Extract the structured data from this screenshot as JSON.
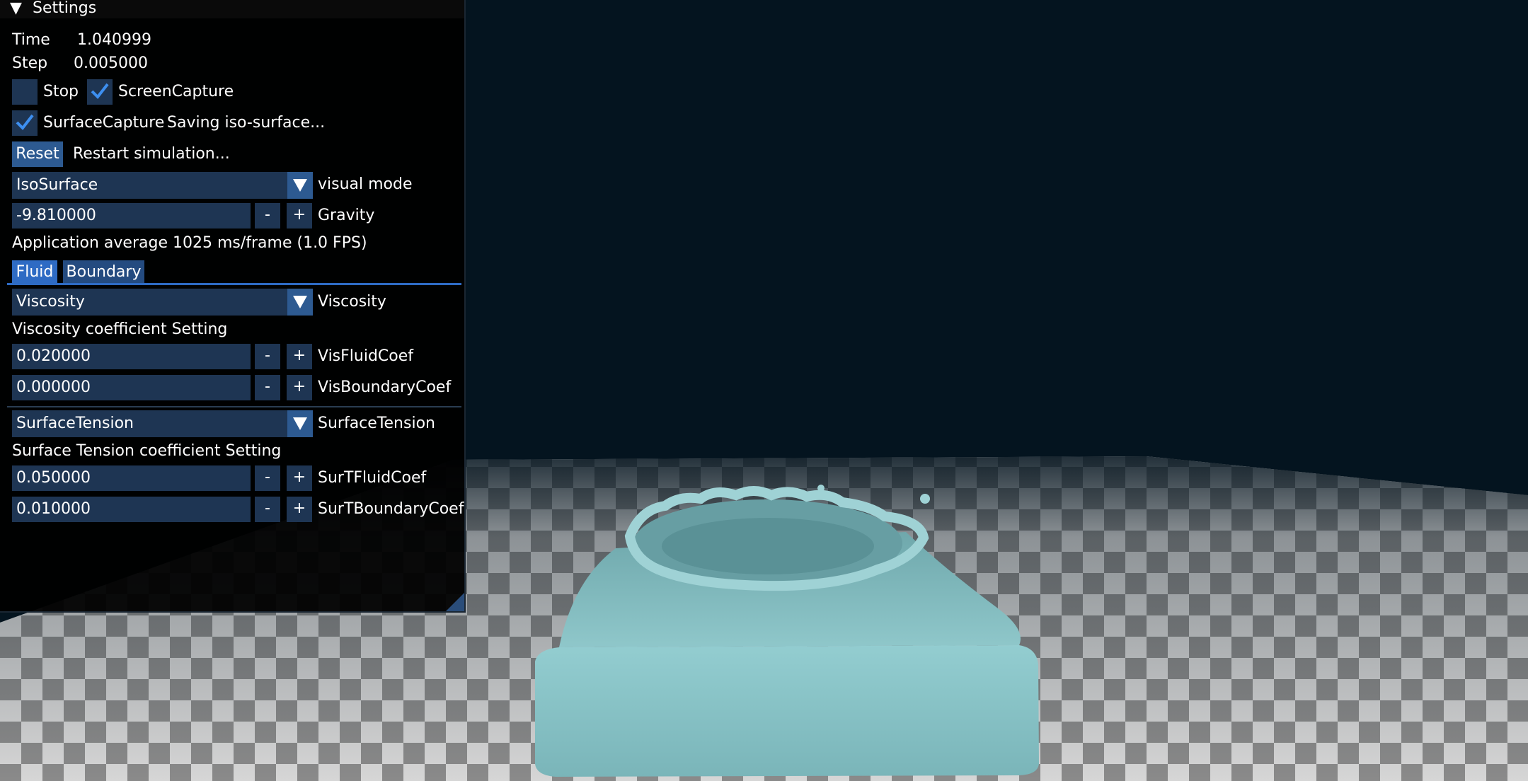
{
  "panel": {
    "title": "Settings",
    "time_label": "Time",
    "time_value": "1.040999",
    "step_label": "Step",
    "step_value": "0.005000",
    "stop_label": "Stop",
    "stop_checked": false,
    "screen_capture_label": "ScreenCapture",
    "screen_capture_checked": true,
    "surface_capture_label": "SurfaceCapture",
    "surface_capture_checked": true,
    "surface_capture_status": "Saving iso-surface...",
    "reset_label": "Reset",
    "reset_status": "Restart simulation...",
    "visual_mode_value": "IsoSurface",
    "visual_mode_label": "visual mode",
    "gravity_value": "-9.810000",
    "gravity_label": "Gravity",
    "fps_text": "Application average 1025 ms/frame (1.0 FPS)",
    "tabs": [
      {
        "label": "Fluid",
        "active": true
      },
      {
        "label": "Boundary",
        "active": false
      }
    ],
    "viscosity_combo_value": "Viscosity",
    "viscosity_combo_label": "Viscosity",
    "viscosity_heading": "Viscosity coefficient Setting",
    "vis_fluid_value": "0.020000",
    "vis_fluid_label": "VisFluidCoef",
    "vis_boundary_value": "0.000000",
    "vis_boundary_label": "VisBoundaryCoef",
    "surface_tension_combo_value": "SurfaceTension",
    "surface_tension_combo_label": "SurfaceTension",
    "surface_tension_heading": "Surface Tension coefficient Setting",
    "surt_fluid_value": "0.050000",
    "surt_fluid_label": "SurTFluidCoef",
    "surt_boundary_value": "0.010000",
    "surt_boundary_label": "SurTBoundaryCoef",
    "minus_symbol": "-",
    "plus_symbol": "+"
  },
  "colors": {
    "sky": "#04141f",
    "fluid": "#87c3c6",
    "checker_light": "#d6d6d6",
    "checker_dark": "#8a8a8a",
    "accent": "#2e6bc4",
    "frame_bg": "#1e3553"
  },
  "icons": {
    "collapse": "triangle-down-icon",
    "check": "checkmark-icon",
    "combo_arrow": "triangle-down-icon"
  }
}
